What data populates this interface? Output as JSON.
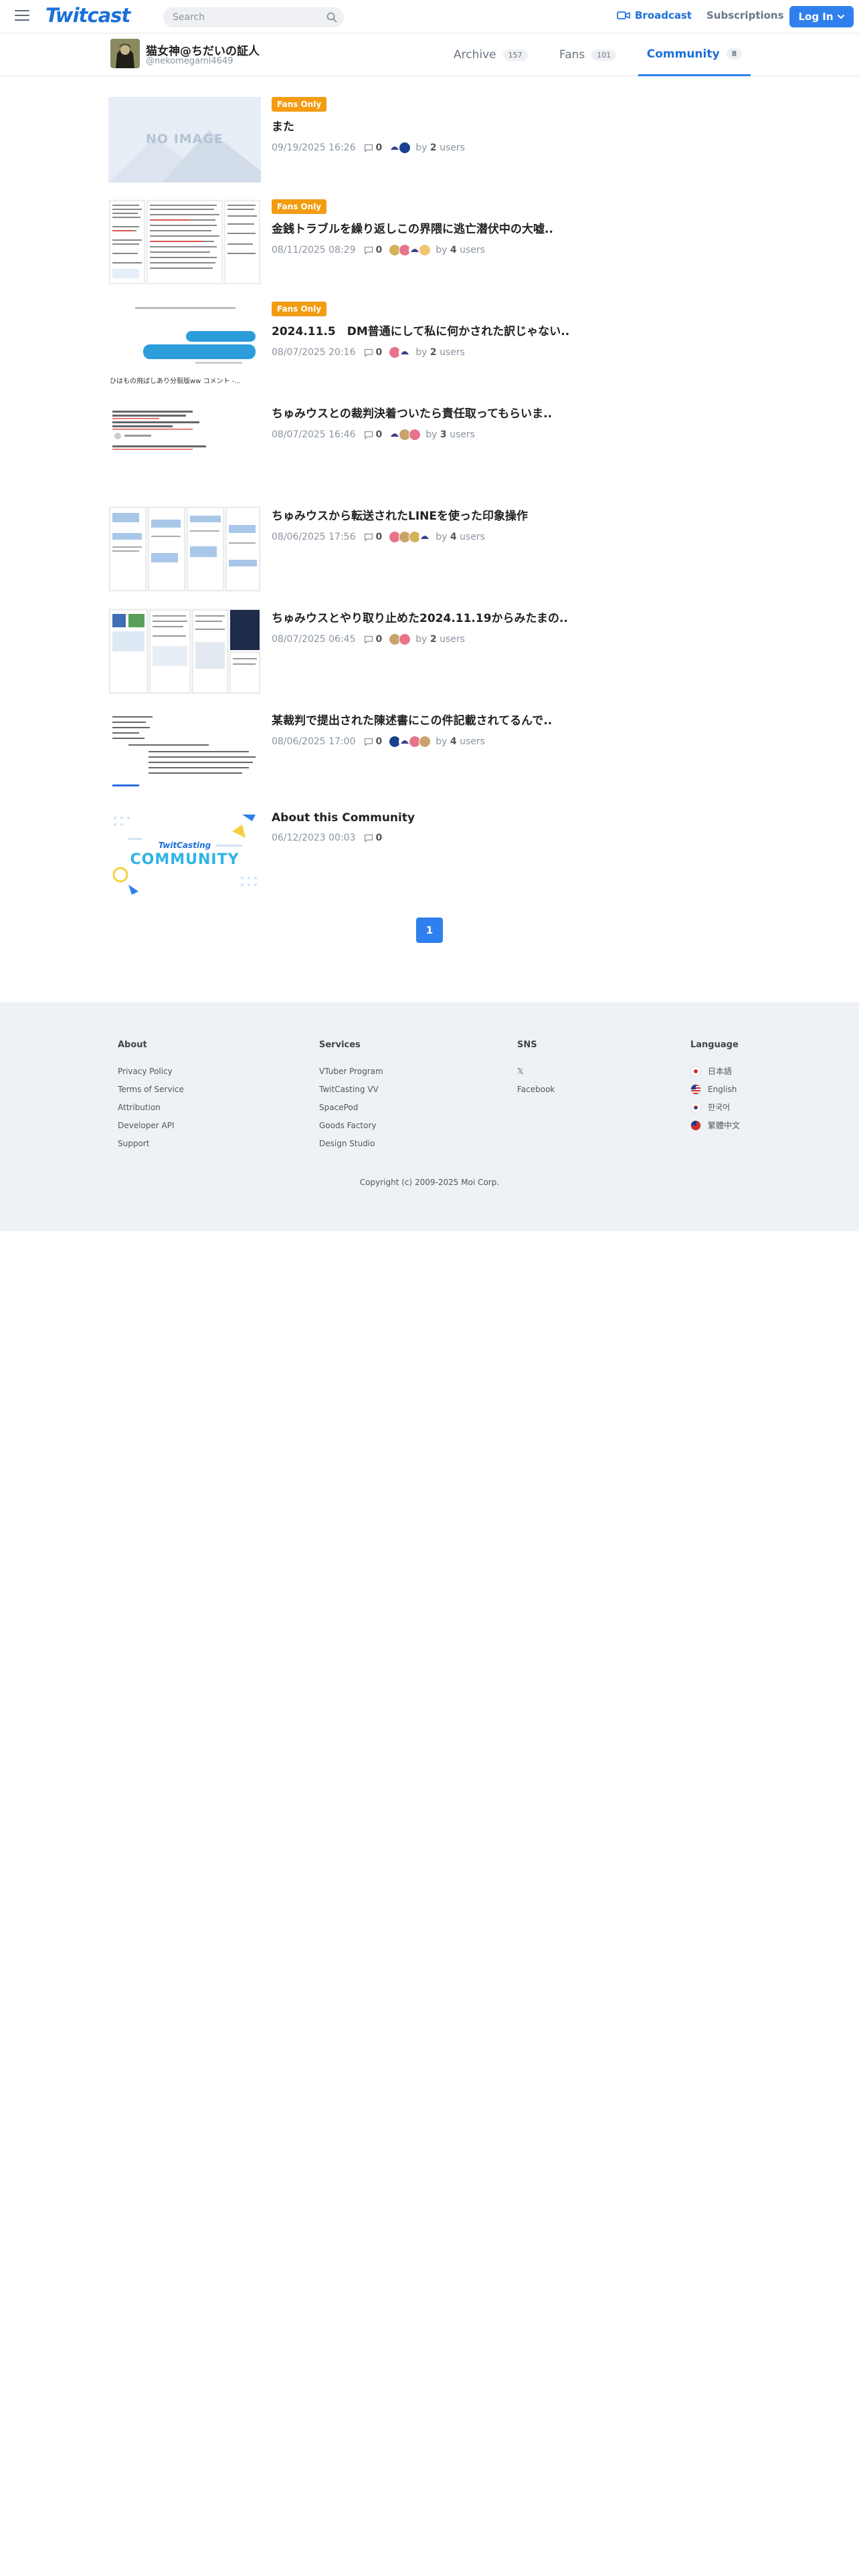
{
  "header": {
    "logo": "Twitcast",
    "search_placeholder": "Search",
    "broadcast": "Broadcast",
    "subscriptions": "Subscriptions",
    "login": "Log In"
  },
  "profile": {
    "name": "猫女神@ちだいの証人",
    "id": "@nekomegami4649"
  },
  "tabs": [
    {
      "label": "Archive",
      "count": "157"
    },
    {
      "label": "Fans",
      "count": "101"
    },
    {
      "label": "Community",
      "count": "8"
    }
  ],
  "posts": [
    {
      "badge": "Fans Only",
      "title": "また",
      "date": "09/19/2025 16:26",
      "comments": "0",
      "by_count": "2",
      "by_label": "by",
      "users_label": "users",
      "thumb": "NO IMAGE"
    },
    {
      "badge": "Fans Only",
      "title": "金銭トラブルを繰り返しこの界隈に逃亡潜伏中の大嘘..",
      "date": "08/11/2025 08:29",
      "comments": "0",
      "by_count": "4",
      "by_label": "by",
      "users_label": "users"
    },
    {
      "badge": "Fans Only",
      "title": "2024.11.5　DM普通にして私に何かされた訳じゃない..",
      "date": "08/07/2025 20:16",
      "comments": "0",
      "by_count": "2",
      "by_label": "by",
      "users_label": "users"
    },
    {
      "badge": "",
      "title": "ちゅみウスとの裁判決着ついたら責任取ってもらいま..",
      "date": "08/07/2025 16:46",
      "comments": "0",
      "by_count": "3",
      "by_label": "by",
      "users_label": "users"
    },
    {
      "badge": "",
      "title": "ちゅみウスから転送されたLINEを使った印象操作",
      "date": "08/06/2025 17:56",
      "comments": "0",
      "by_count": "4",
      "by_label": "by",
      "users_label": "users"
    },
    {
      "badge": "",
      "title": "ちゅみウスとやり取り止めた2024.11.19からみたまの..",
      "date": "08/07/2025 06:45",
      "comments": "0",
      "by_count": "2",
      "by_label": "by",
      "users_label": "users"
    },
    {
      "badge": "",
      "title": "某裁判で提出された陳述書にこの件記載されてるんで..",
      "date": "08/06/2025 17:00",
      "comments": "0",
      "by_count": "4",
      "by_label": "by",
      "users_label": "users"
    },
    {
      "badge": "",
      "title": "About this Community",
      "date": "06/12/2023 00:03",
      "comments": "0",
      "by_count": "",
      "by_label": "",
      "users_label": "",
      "thumb_brand": "TwitCasting",
      "thumb_text": "COMMUNITY"
    }
  ],
  "thumb_texts": {
    "post3_caption": "ひはもの飛ばしあり分裂版ww コメント -..."
  },
  "pagination": {
    "current": "1"
  },
  "footer": {
    "about": {
      "heading": "About",
      "links": [
        "Privacy Policy",
        "Terms of Service",
        "Attribution",
        "Developer API",
        "Support"
      ]
    },
    "services": {
      "heading": "Services",
      "links": [
        "VTuber Program",
        "TwitCasting VV",
        "SpacePod",
        "Goods Factory",
        "Design Studio"
      ]
    },
    "sns": {
      "heading": "SNS",
      "links": [
        "𝕏",
        "Facebook"
      ]
    },
    "language": {
      "heading": "Language",
      "links": [
        "日本語",
        "English",
        "한국어",
        "繁體中文"
      ]
    },
    "copyright": "Copyright (c) 2009-2025 Moi Corp."
  },
  "colors": {
    "accent": "#2f80ed",
    "badge": "#f39c12",
    "footer_bg": "#eef1f5"
  }
}
